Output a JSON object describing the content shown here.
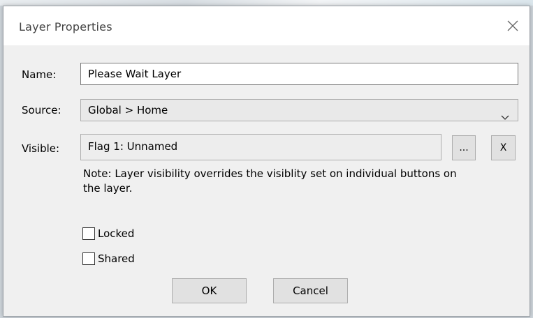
{
  "window": {
    "title": "Layer Properties",
    "close_icon": "close-icon"
  },
  "form": {
    "name": {
      "label": "Name:",
      "value": "Please Wait Layer"
    },
    "source": {
      "label": "Source:",
      "value": "Global > Home",
      "icon": "chevron-down-icon"
    },
    "visible": {
      "label": "Visible:",
      "value": "Flag 1: Unnamed",
      "browse_label": "...",
      "clear_label": "X"
    },
    "note": "Note: Layer visibility overrides the visiblity set on individual buttons on the layer.",
    "locked": {
      "label": "Locked",
      "checked": false
    },
    "shared": {
      "label": "Shared",
      "checked": false
    }
  },
  "buttons": {
    "ok": "OK",
    "cancel": "Cancel"
  },
  "colors": {
    "dialog_bg": "#f0f0f0",
    "titlebar_bg": "#ffffff",
    "button_bg": "#e1e1e1"
  }
}
